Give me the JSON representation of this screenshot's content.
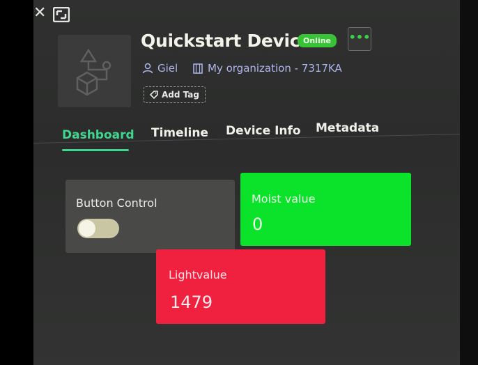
{
  "window": {
    "close_icon": "close-icon",
    "expand_icon": "fullscreen-icon"
  },
  "device": {
    "name": "Quickstart Device",
    "status": "Online",
    "status_color": "#38c236",
    "owner": "Giel",
    "organization": "My organization - 7317KA",
    "add_tag_label": "Add Tag",
    "more_label": "•••"
  },
  "tabs": [
    {
      "label": "Dashboard",
      "active": true
    },
    {
      "label": "Timeline",
      "active": false
    },
    {
      "label": "Device Info",
      "active": false
    },
    {
      "label": "Metadata",
      "active": false
    }
  ],
  "accent_color": "#3fd68f",
  "widgets": {
    "button_control": {
      "label": "Button Control",
      "state": "off"
    },
    "moist": {
      "label": "Moist value",
      "value": "0",
      "color": "#0be32a"
    },
    "light": {
      "label": "Lightvalue",
      "value": "1479",
      "color": "#f0203f"
    }
  }
}
